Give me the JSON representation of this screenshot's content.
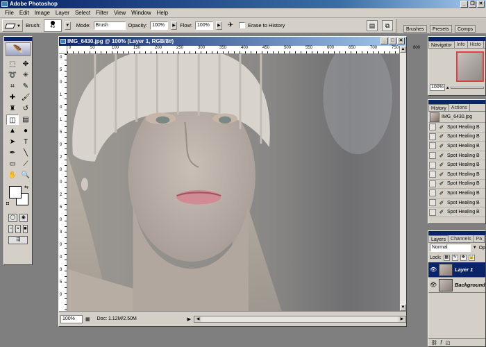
{
  "app": {
    "title": "Adobe Photoshop"
  },
  "menu": [
    "File",
    "Edit",
    "Image",
    "Layer",
    "Select",
    "Filter",
    "View",
    "Window",
    "Help"
  ],
  "options": {
    "brush_label": "Brush:",
    "brush_size": "45",
    "mode_label": "Mode:",
    "mode_value": "Brush",
    "opacity_label": "Opacity:",
    "opacity_value": "100%",
    "flow_label": "Flow:",
    "flow_value": "100%",
    "erase_history_label": "Erase to History"
  },
  "palette_well": {
    "tabs": [
      "Brushes",
      "Presets",
      "Comps"
    ]
  },
  "document": {
    "title": "IMG_6430.jpg @ 100% (Layer 1, RGB/8#)",
    "ruler_h": [
      "0",
      "50",
      "100",
      "150",
      "200",
      "250",
      "300",
      "350",
      "400",
      "450",
      "500",
      "550",
      "600",
      "650",
      "700",
      "750",
      "800"
    ],
    "ruler_v": [
      "0",
      "5",
      "0",
      "1",
      "0",
      "1",
      "5",
      "0",
      "2",
      "0",
      "0",
      "2",
      "5",
      "0",
      "3",
      "0",
      "0",
      "3",
      "5",
      "0"
    ],
    "zoom": "100%",
    "doc_info": "Doc: 1.12M/2.50M"
  },
  "navigator": {
    "tabs": [
      "Navigator",
      "Info",
      "Histo"
    ],
    "zoom": "100%"
  },
  "history": {
    "tabs": [
      "History",
      "Actions"
    ],
    "snapshot": "IMG_6430.jpg",
    "items": [
      "Spot Healing B",
      "Spot Healing B",
      "Spot Healing B",
      "Spot Healing B",
      "Spot Healing B",
      "Spot Healing B",
      "Spot Healing B",
      "Spot Healing B",
      "Spot Healing B",
      "Spot Healing B"
    ]
  },
  "layers": {
    "tabs": [
      "Layers",
      "Channels",
      "Pa"
    ],
    "blend_mode": "Normal",
    "opacity_short": "Op",
    "lock_label": "Lock:",
    "items": [
      {
        "name": "Layer 1",
        "selected": true
      },
      {
        "name": "Background",
        "selected": false
      }
    ]
  }
}
